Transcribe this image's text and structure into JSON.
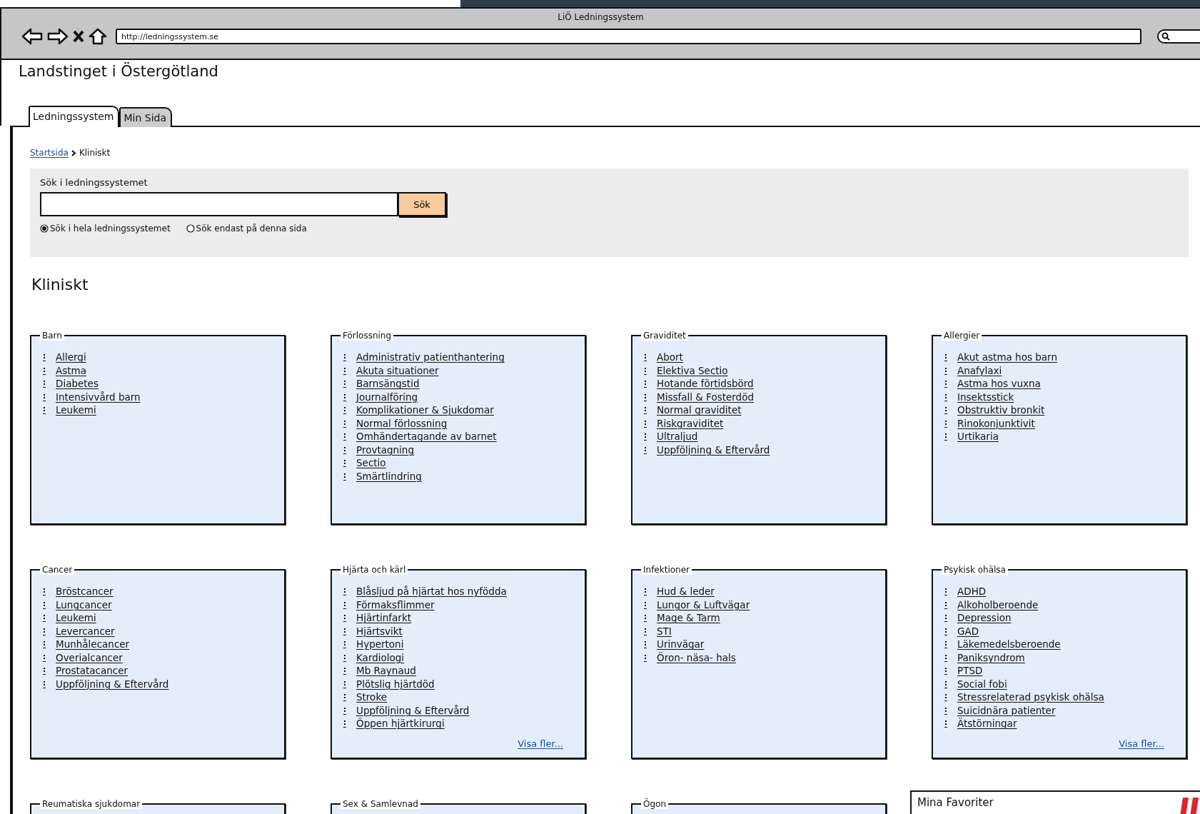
{
  "window": {
    "title": "LiÖ Ledningssystem",
    "url": "http://ledningssystem.se"
  },
  "site_title": "Landstinget i Östergötland",
  "tabs": [
    {
      "label": "Ledningssystem",
      "selected": true
    },
    {
      "label": "Min Sida",
      "selected": false
    }
  ],
  "breadcrumb": [
    {
      "label": "Startsida",
      "kind": "link"
    },
    {
      "label": "Kliniskt",
      "kind": "current"
    }
  ],
  "search": {
    "label": "Sök i ledningssystemet",
    "button": "Sök",
    "options": [
      {
        "label": "Sök i hela ledningssystemet",
        "selected": true
      },
      {
        "label": "Sök endast på denna sida",
        "selected": false
      }
    ]
  },
  "section_title": "Kliniskt",
  "panels": [
    {
      "title": "Barn",
      "links": [
        "Allergi",
        "Astma",
        "Diabetes",
        "Intensivvård barn",
        "Leukemi"
      ]
    },
    {
      "title": "Förlossning",
      "links": [
        "Administrativ patienthantering",
        "Akuta situationer",
        "Barnsängstid",
        "Journalföring",
        "Komplikationer & Sjukdomar",
        "Normal förlossning",
        "Omhändertagande av barnet",
        "Provtagning",
        "Sectio",
        "Smärtlindring"
      ]
    },
    {
      "title": "Graviditet",
      "links": [
        "Abort",
        "Elektiva Sectio",
        "Hotande förtidsbörd",
        "Missfall & Fosterdöd",
        "Normal graviditet",
        "Riskgraviditet",
        "Ultraljud",
        "Uppföljning & Eftervård"
      ]
    },
    {
      "title": "Allergier",
      "links": [
        "Akut astma hos barn",
        "Anafylaxi",
        "Astma hos vuxna",
        "Insektsstick",
        "Obstruktiv bronkit",
        "Rinokonjunktivit",
        "Urtikaria"
      ]
    },
    {
      "title": "Cancer",
      "links": [
        "Bröstcancer",
        "Lungcancer",
        "Leukemi",
        "Levercancer",
        "Munhålecancer",
        "Overialcancer",
        "Prostatacancer",
        "Uppföljning & Eftervård"
      ]
    },
    {
      "title": "Hjärta och kärl",
      "links": [
        "Blåsljud på hjärtat hos nyfödda",
        "Förmaksflimmer",
        "Hjärtinfarkt",
        "Hjärtsvikt",
        "Hypertoni",
        "Kardiologi",
        "Mb Raynaud",
        "Plötslig hjärtdöd",
        "Stroke",
        "Uppföljning & Eftervård",
        "Öppen hjärtkirurgi"
      ],
      "more": "Visa fler..."
    },
    {
      "title": "Infektioner",
      "links": [
        "Hud & leder",
        "Lungor & Luftvägar",
        "Mage & Tarm",
        "STI",
        "Urinvägar",
        "Öron- näsa- hals"
      ]
    },
    {
      "title": "Psykisk ohälsa",
      "links": [
        "ADHD",
        "Alkoholberoende",
        "Depression",
        "GAD",
        "Läkemedelsberoende",
        "Paniksyndrom",
        "PTSD",
        "Social fobi",
        "Stressrelaterad psykisk ohälsa",
        "Suicidnära patienter",
        "Ätstörningar"
      ],
      "more": "Visa fler..."
    },
    {
      "title": "Reumatiska sjukdomar"
    },
    {
      "title": "Sex & Samlevnad"
    },
    {
      "title": "Ögon"
    }
  ],
  "favorites": {
    "title": "Mina Favoriter"
  }
}
